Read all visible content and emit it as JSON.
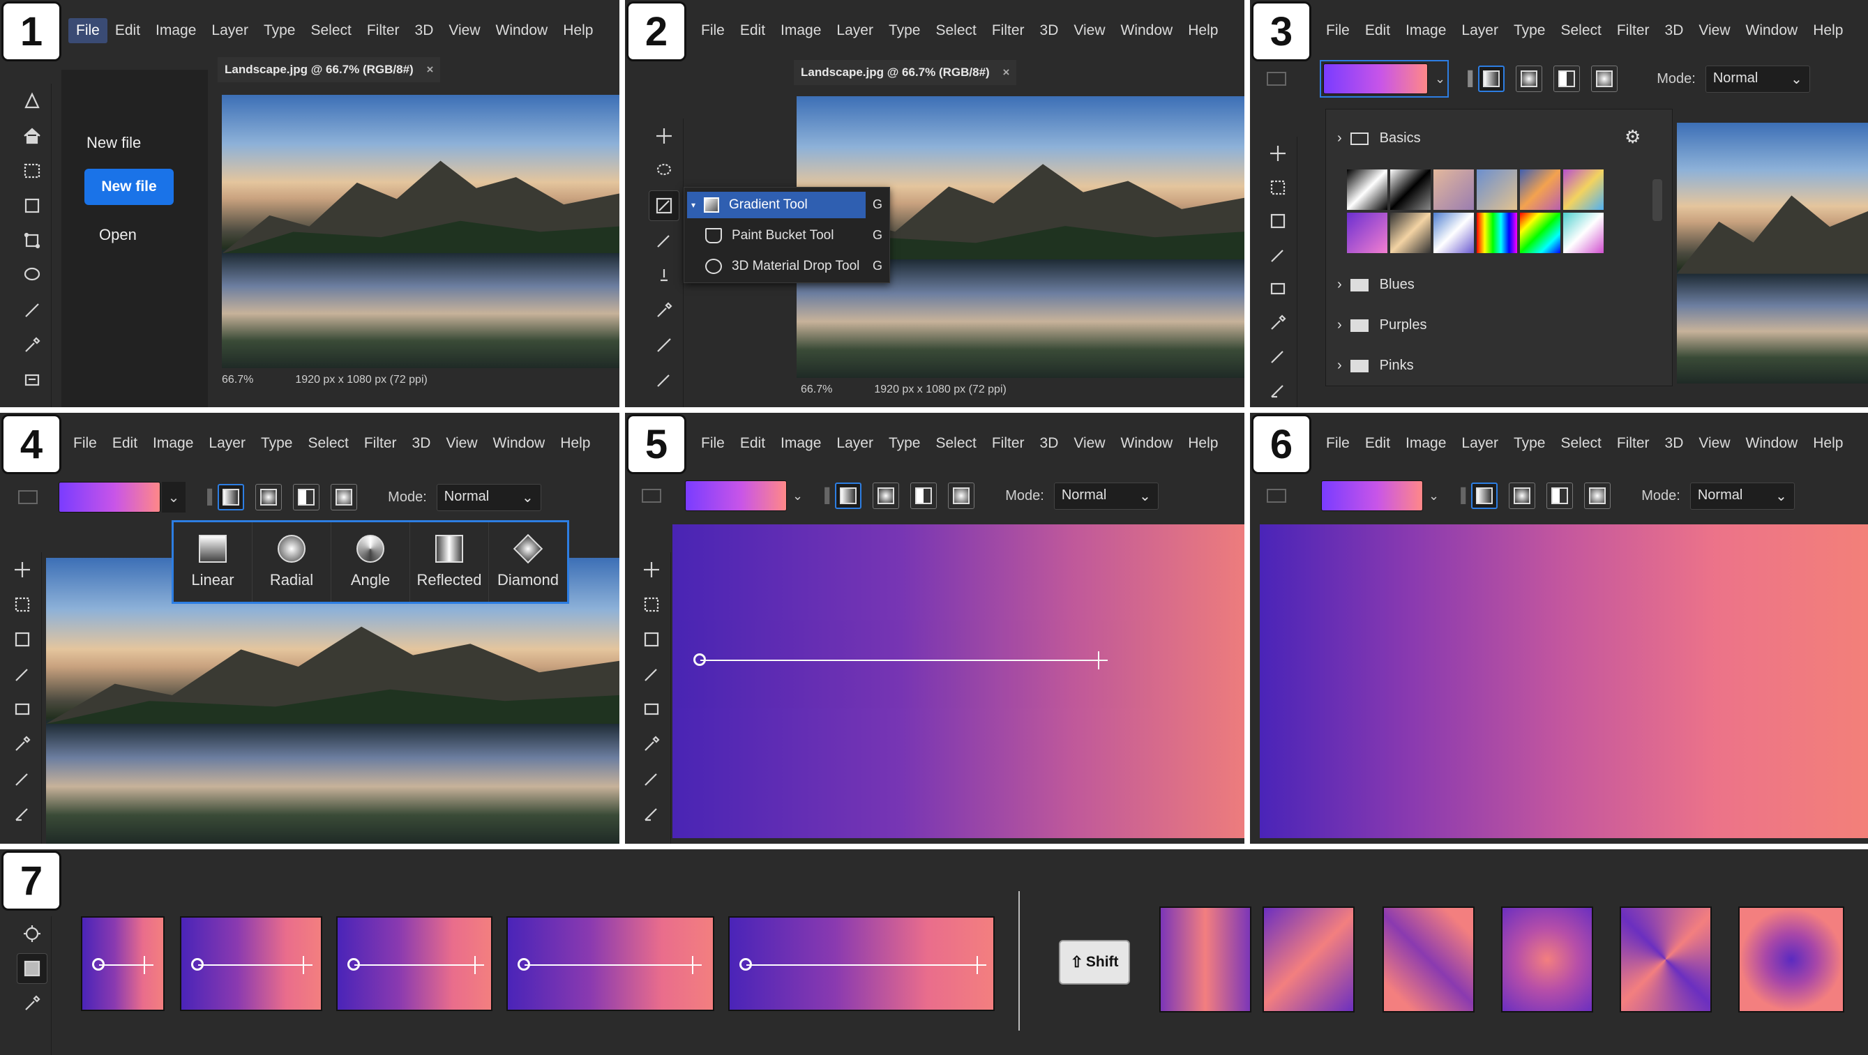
{
  "menu": [
    "File",
    "Edit",
    "Image",
    "Layer",
    "Type",
    "Select",
    "Filter",
    "3D",
    "View",
    "Window",
    "Help"
  ],
  "steps": [
    "1",
    "2",
    "3",
    "4",
    "5",
    "6",
    "7"
  ],
  "panel1": {
    "doc_tab": "Landscape.jpg @ 66.7% (RGB/8#)",
    "close": "×",
    "start_menu": {
      "new_file_label": "New file",
      "new_file_button": "New file",
      "open": "Open"
    },
    "zoom": "66.7%",
    "dimensions": "1920 px x 1080 px (72 ppi)"
  },
  "panel2": {
    "doc_tab": "Landscape.jpg @ 66.7% (RGB/8#)",
    "close": "×",
    "flyout": [
      {
        "label": "Gradient Tool",
        "key": "G",
        "selected": true
      },
      {
        "label": "Paint Bucket Tool",
        "key": "G",
        "selected": false
      },
      {
        "label": "3D Material Drop Tool",
        "key": "G",
        "selected": false
      }
    ],
    "zoom": "66.7%",
    "dimensions": "1920 px x 1080 px (72 ppi)"
  },
  "panel3": {
    "mode_label": "Mode:",
    "mode_value": "Normal",
    "folders": [
      "Basics",
      "Blues",
      "Purples",
      "Pinks"
    ]
  },
  "panel4": {
    "mode_label": "Mode:",
    "mode_value": "Normal",
    "gradient_types": [
      "Linear",
      "Radial",
      "Angle",
      "Reflected",
      "Diamond"
    ]
  },
  "panel5": {
    "mode_label": "Mode:",
    "mode_value": "Normal"
  },
  "panel6": {
    "mode_label": "Mode:",
    "mode_value": "Normal"
  },
  "panel7": {
    "shift_key": "Shift"
  },
  "colors": {
    "gradient_start": "#4a24b8",
    "gradient_mid": "#a547a8",
    "gradient_end": "#f37f7f",
    "accent": "#2d7ee3"
  }
}
